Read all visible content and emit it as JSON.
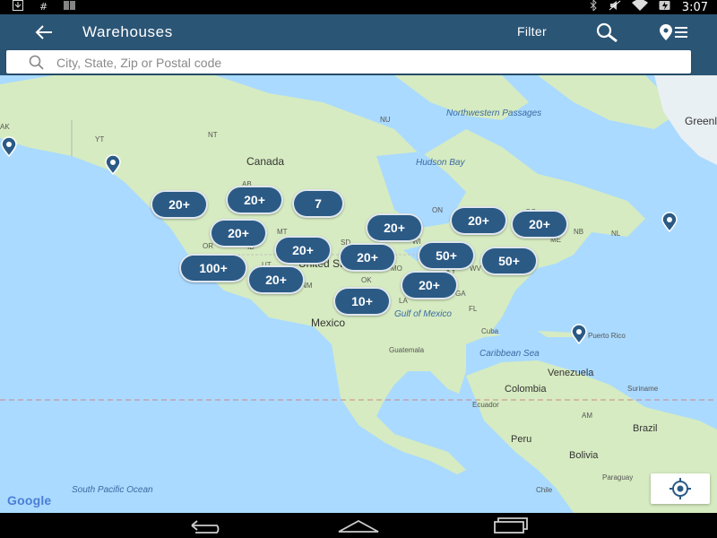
{
  "status_bar": {
    "time": "3:07",
    "left_icons": [
      "download-icon",
      "hash-icon",
      "barcode-icon"
    ],
    "right_icons": [
      "bluetooth-icon",
      "mute-icon",
      "wifi-icon",
      "battery-icon"
    ]
  },
  "app_bar": {
    "title": "Warehouses",
    "filter_label": "Filter"
  },
  "search": {
    "placeholder": "City, State, Zip or Postal code",
    "value": ""
  },
  "map": {
    "country_labels": [
      "Canada",
      "United St",
      "Mexico",
      "Cuba",
      "Puerto Rico",
      "Guatemala",
      "Venezuela",
      "Colombia",
      "Ecuador",
      "Peru",
      "Brazil",
      "Bolivia",
      "Chile",
      "Paraguay",
      "Suriname",
      "Greenland",
      "AM"
    ],
    "state_labels": [
      "YT",
      "NT",
      "NU",
      "AB",
      "MT",
      "SD",
      "OR",
      "ID",
      "WI",
      "ON",
      "QC",
      "NB",
      "ME",
      "MO",
      "KY",
      "WV",
      "OK",
      "GA",
      "LA",
      "NM",
      "FL",
      "AK",
      "UT",
      "NL"
    ],
    "water_labels": [
      "Hudson Bay",
      "Northwestern Passages",
      "Gulf of Mexico",
      "Caribbean Sea",
      "South Pacific Ocean"
    ],
    "clusters": [
      {
        "label": "20+"
      },
      {
        "label": "20+"
      },
      {
        "label": "7"
      },
      {
        "label": "20+"
      },
      {
        "label": "20+"
      },
      {
        "label": "20+"
      },
      {
        "label": "20+"
      },
      {
        "label": "20+"
      },
      {
        "label": "100+"
      },
      {
        "label": "20+"
      },
      {
        "label": "20+"
      },
      {
        "label": "50+"
      },
      {
        "label": "50+"
      },
      {
        "label": "20+"
      },
      {
        "label": "10+"
      }
    ],
    "attribution": "Google"
  },
  "colors": {
    "app_bar": "#2b5575",
    "cluster": "#2b5a85",
    "water": "#aadaff",
    "land": "#d6ebc1"
  }
}
